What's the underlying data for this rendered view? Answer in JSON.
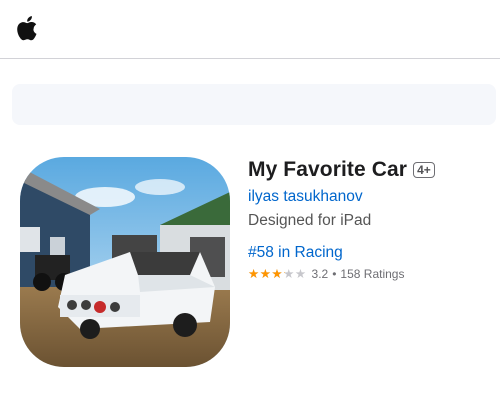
{
  "header": {
    "logo_icon": "apple-logo-icon"
  },
  "app": {
    "title": "My Favorite Car",
    "age_rating": "4+",
    "developer": "ilyas tasukhanov",
    "designed_for": "Designed for iPad",
    "rank": "#58 in Racing",
    "rating": {
      "value": "3.2",
      "separator": "•",
      "count_label": "158 Ratings",
      "stars_fraction": 0.64,
      "stars_glyphs": "★★★★★"
    },
    "icon": "car-game-app-icon"
  },
  "colors": {
    "link": "#0066cc",
    "star": "#ff9500",
    "star_empty": "#c7c7cc",
    "banner": "#f5f7fb"
  }
}
